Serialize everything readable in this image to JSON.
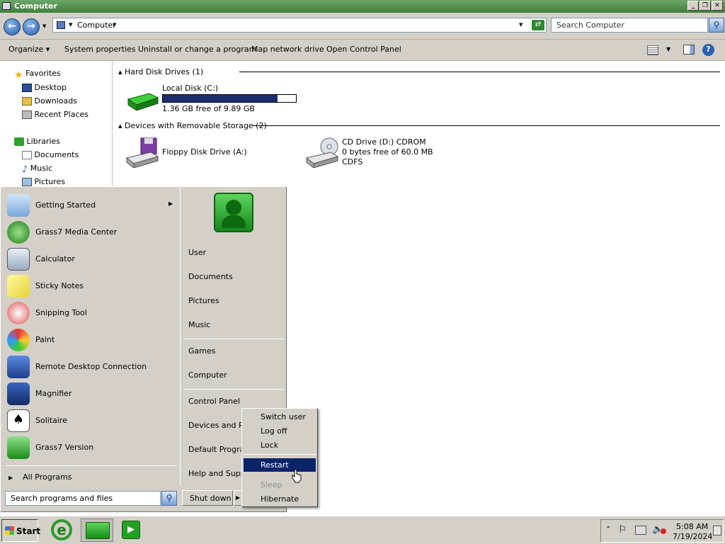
{
  "window": {
    "title": "Computer"
  },
  "address": {
    "crumb": "Computer",
    "search_placeholder": "Search Computer"
  },
  "commands": [
    "Organize",
    "System properties",
    "Uninstall or change a program",
    "Map network drive",
    "Open Control Panel"
  ],
  "nav": {
    "favorites_label": "Favorites",
    "favorites": [
      "Desktop",
      "Downloads",
      "Recent Places"
    ],
    "libraries_label": "Libraries",
    "libraries": [
      "Documents",
      "Music",
      "Pictures"
    ]
  },
  "content": {
    "hdd_group": "Hard Disk Drives (1)",
    "hdd": {
      "name": "Local Disk (C:)",
      "free": "1.36 GB free of 9.89 GB",
      "used_fraction": 0.86
    },
    "removable_group": "Devices with Removable Storage (2)",
    "floppy": {
      "name": "Floppy Disk Drive (A:)"
    },
    "cd": {
      "name": "CD Drive (D:) CDROM",
      "free": "0 bytes free of 60.0 MB",
      "fs": "CDFS"
    }
  },
  "start_menu": {
    "programs": [
      "Getting Started",
      "Grass7 Media Center",
      "Calculator",
      "Sticky Notes",
      "Snipping Tool",
      "Paint",
      "Remote Desktop Connection",
      "Magnifier",
      "Solitaire",
      "Grass7 Version"
    ],
    "all_programs": "All Programs",
    "search_placeholder": "Search programs and files",
    "right_links": [
      "User",
      "Documents",
      "Pictures",
      "Music",
      "Games",
      "Computer",
      "Control Panel",
      "Devices and Pri",
      "Default Program",
      "Help and Suppo"
    ],
    "shutdown_label": "Shut down"
  },
  "power_menu": {
    "items": [
      "Switch user",
      "Log off",
      "Lock",
      "Restart",
      "Sleep",
      "Hibernate"
    ],
    "selected": "Restart",
    "disabled": "Sleep"
  },
  "taskbar": {
    "start_label": "Start",
    "time": "5:08 AM",
    "date": "7/19/2024"
  }
}
